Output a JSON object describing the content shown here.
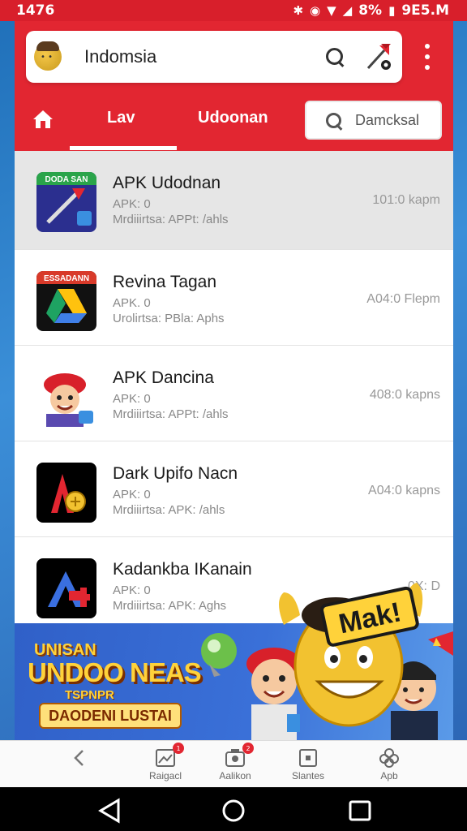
{
  "status_bar": {
    "time": "1476",
    "battery": "8%",
    "clock_right": "9E5.M"
  },
  "header": {
    "search_title": "Indomsia",
    "tabs": [
      {
        "label": "Lav",
        "active": true
      },
      {
        "label": "Udoonan",
        "active": false
      }
    ],
    "search_placeholder": "Damcksal"
  },
  "apps": [
    {
      "title": "APK Udodnan",
      "line1": "APK: 0",
      "line2": "Mrdiiirtsa: APPt: /ahls",
      "meta": "101:0 kapm",
      "icon_text": "DODA SAN"
    },
    {
      "title": "Revina Tagan",
      "line1": "APK. 0",
      "line2": "Urolirtsa: PBla: Aphs",
      "meta": "A04:0 Flepm",
      "icon_text": "ESSADANN"
    },
    {
      "title": "APK Dancina",
      "line1": "APK: 0",
      "line2": "Mrdiiirtsa: APPt: /ahls",
      "meta": "408:0 kapns",
      "icon_text": ""
    },
    {
      "title": "Dark Upifo Nacn",
      "line1": "APK: 0",
      "line2": "Mrdiiirtsa: APK: /ahls",
      "meta": "A04:0 kapns",
      "icon_text": ""
    },
    {
      "title": "Kadankba IKanain",
      "line1": "APK: 0",
      "line2": "Mrdiiirtsa: APK: Aghs",
      "meta": "0X: D",
      "icon_text": ""
    }
  ],
  "banner": {
    "kicker": "UNISAN",
    "headline": "UNDOO NEAS",
    "sub": "TSPNPR",
    "cta": "DAODENI LUSTAI",
    "mascot_text": "Mak!"
  },
  "bottom_nav": [
    {
      "label": "",
      "icon": "back-chevron-icon"
    },
    {
      "label": "Raigacl",
      "icon": "gallery-icon",
      "badge": "1"
    },
    {
      "label": "Aalikon",
      "icon": "camera-icon",
      "badge": "2"
    },
    {
      "label": "Slantes",
      "icon": "square-icon"
    },
    {
      "label": "Apb",
      "icon": "flower-icon"
    }
  ],
  "colors": {
    "primary_red": "#e22631",
    "list_bg": "#ffffff",
    "selected_row": "#e6e6e6"
  }
}
